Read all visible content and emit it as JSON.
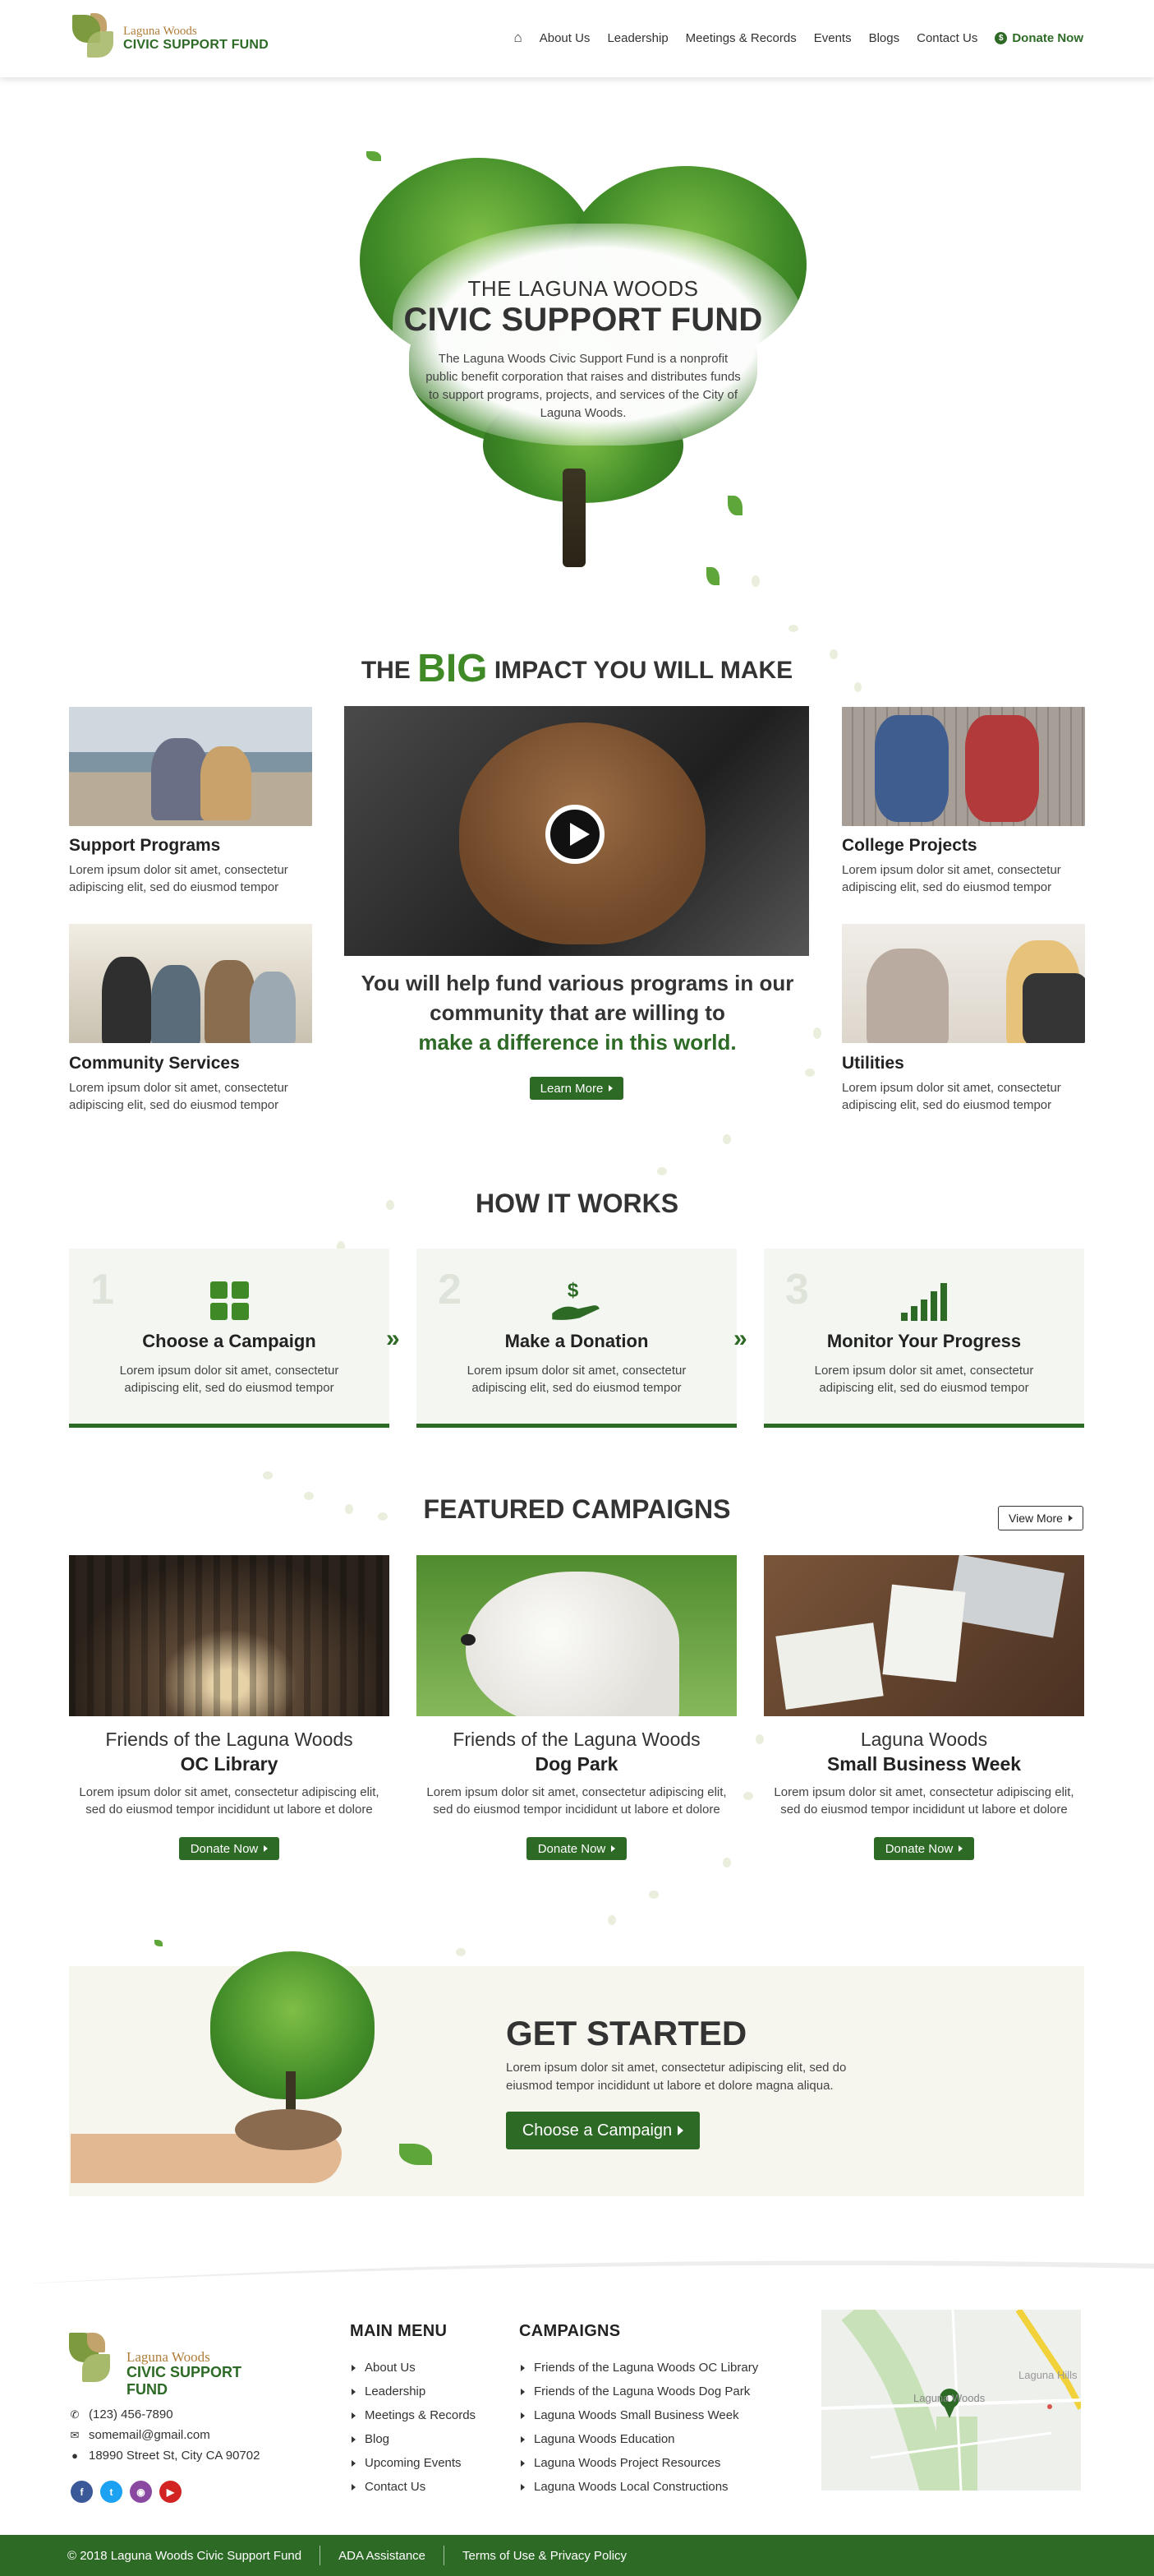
{
  "header": {
    "logo_line1": "Laguna Woods",
    "logo_line2": "CIVIC SUPPORT FUND",
    "nav": [
      "About Us",
      "Leadership",
      "Meetings & Records",
      "Events",
      "Blogs",
      "Contact Us"
    ],
    "donate": "Donate Now"
  },
  "hero": {
    "kicker": "THE LAGUNA WOODS",
    "title": "CIVIC SUPPORT FUND",
    "description": "The Laguna Woods Civic Support Fund is a nonprofit public benefit corporation that raises and distributes funds to support programs, projects, and services of the City of Laguna Woods."
  },
  "impact": {
    "title_pre": "THE",
    "title_big": "BIG",
    "title_post": "IMPACT YOU WILL MAKE",
    "cards": [
      {
        "title": "Support Programs",
        "text": "Lorem ipsum dolor sit amet, consectetur adipiscing elit, sed do eiusmod tempor"
      },
      {
        "title": "Community Services",
        "text": "Lorem ipsum dolor sit amet, consectetur adipiscing elit, sed do eiusmod tempor"
      },
      {
        "title": "College Projects",
        "text": "Lorem ipsum dolor sit amet, consectetur adipiscing elit, sed do eiusmod tempor"
      },
      {
        "title": "Utilities",
        "text": "Lorem ipsum dolor sit amet, consectetur adipiscing elit, sed do eiusmod tempor"
      }
    ],
    "message": "You will help fund various programs in our community that are willing to",
    "message_green": "make a difference in this world.",
    "learn_more": "Learn More"
  },
  "how_it_works": {
    "title": "HOW IT WORKS",
    "steps": [
      {
        "num": "1",
        "title": "Choose a Campaign",
        "text": "Lorem ipsum dolor sit amet, consectetur adipiscing elit, sed do eiusmod tempor"
      },
      {
        "num": "2",
        "title": "Make a Donation",
        "text": "Lorem ipsum dolor sit amet, consectetur adipiscing elit, sed do eiusmod tempor"
      },
      {
        "num": "3",
        "title": "Monitor Your Progress",
        "text": "Lorem ipsum dolor sit amet, consectetur adipiscing elit, sed do eiusmod tempor"
      }
    ]
  },
  "featured": {
    "title": "FEATURED CAMPAIGNS",
    "view_more": "View More",
    "campaigns": [
      {
        "pre": "Friends of the Laguna Woods",
        "name": "OC Library",
        "desc": "Lorem ipsum dolor sit amet, consectetur adipiscing elit, sed do eiusmod tempor incididunt ut labore et dolore",
        "button": "Donate Now"
      },
      {
        "pre": "Friends of the Laguna Woods",
        "name": "Dog Park",
        "desc": "Lorem ipsum dolor sit amet, consectetur adipiscing elit, sed do eiusmod tempor incididunt ut labore et dolore",
        "button": "Donate Now"
      },
      {
        "pre": "Laguna Woods",
        "name": "Small Business Week",
        "desc": "Lorem ipsum dolor sit amet, consectetur adipiscing elit, sed do eiusmod tempor incididunt ut labore et dolore",
        "button": "Donate Now"
      }
    ]
  },
  "get_started": {
    "title": "GET STARTED",
    "text": "Lorem ipsum dolor sit amet, consectetur adipiscing elit, sed do eiusmod tempor incididunt ut labore et dolore magna aliqua.",
    "button": "Choose a Campaign"
  },
  "footer": {
    "phone": "(123) 456-7890",
    "email": "somemail@gmail.com",
    "address": "18990 Street St, City CA 90702",
    "main_menu_title": "MAIN MENU",
    "main_menu": [
      "About Us",
      "Leadership",
      "Meetings & Records",
      "Blog",
      "Upcoming Events",
      "Contact Us"
    ],
    "campaigns_title": "CAMPAIGNS",
    "campaigns": [
      "Friends of the Laguna Woods  OC Library",
      "Friends of the Laguna Woods Dog Park",
      "Laguna Woods Small Business Week",
      "Laguna Woods Education",
      "Laguna Woods Project Resources",
      "Laguna Woods Local Constructions"
    ],
    "map_labels": [
      "Laguna Woods",
      "Laguna Hills"
    ],
    "copyright": "© 2018 Laguna Woods Civic Support Fund",
    "ada": "ADA Assistance",
    "terms": "Terms of Use & Privacy Policy"
  },
  "colors": {
    "primary": "#2d6a26",
    "accent_green": "#3f8a27",
    "logo_brown": "#b07d3a",
    "panel": "#f4f7f1"
  }
}
